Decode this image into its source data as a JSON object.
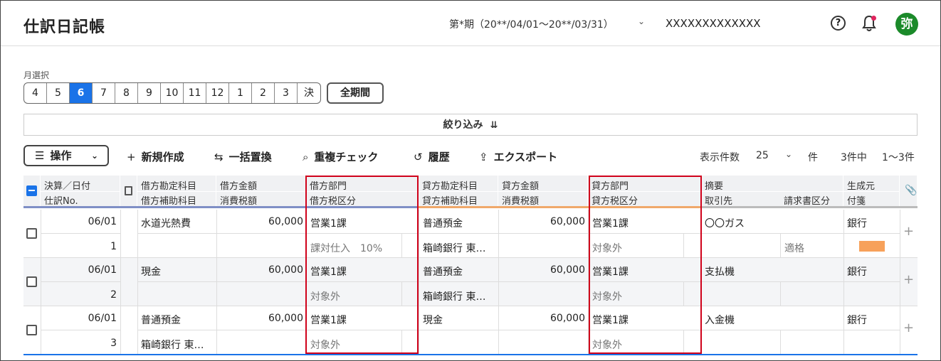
{
  "app": {
    "title": "仕訳日記帳",
    "period": "第*期（20**/04/01〜20**/03/31）",
    "company": "XXXXXXXXXXXXX",
    "avatar": "弥"
  },
  "icons": {
    "period_chevron": "chevron-down-icon",
    "help": "help-icon",
    "bell": "bell-icon",
    "filter": "double-chevron-down-icon",
    "ops_menu": "hamburger-icon",
    "ops_dropdown": "chevron-down-icon",
    "new": "plus-icon",
    "replace": "replace-icon",
    "dup": "search-duplicate-icon",
    "history": "history-icon",
    "export": "export-icon",
    "count_chevron": "chevron-down-icon",
    "book": "book-icon",
    "attach": "paperclip-icon",
    "add_row": "plus-icon"
  },
  "month_select": {
    "label": "月選択",
    "months": [
      "4",
      "5",
      "6",
      "7",
      "8",
      "9",
      "10",
      "11",
      "12",
      "1",
      "2",
      "3",
      "決"
    ],
    "active": "6",
    "all_period": "全期間"
  },
  "filter": {
    "label": "絞り込み"
  },
  "toolbar": {
    "ops": "操作",
    "new": "新規作成",
    "bulk_replace": "一括置換",
    "dup_check": "重複チェック",
    "history": "履歴",
    "export": "エクスポート",
    "count_label": "表示件数",
    "count_value": "25",
    "count_unit": "件",
    "total": "3件中",
    "range": "1〜3件"
  },
  "columns": {
    "date": "決算／日付",
    "no": "仕訳No.",
    "debit_account": "借方勘定科目",
    "debit_sub": "借方補助科目",
    "debit_amount": "借方金額",
    "debit_tax": "消費税額",
    "debit_dept": "借方部門",
    "debit_tax_class": "借方税区分",
    "credit_account": "貸方勘定科目",
    "credit_sub": "貸方補助科目",
    "credit_amount": "貸方金額",
    "credit_tax": "消費税額",
    "credit_dept": "貸方部門",
    "credit_tax_class": "貸方税区分",
    "memo": "摘要",
    "partner": "取引先",
    "invoice": "請求書区分",
    "origin": "生成元",
    "tag": "付箋"
  },
  "colors": {
    "accent": "#1a73e8",
    "debit_bar": "#7f8fc6",
    "credit_bar": "#f0a86a",
    "highlight": "#d0021b",
    "tag": "#f7a15a",
    "avatar": "#1b8a2a"
  },
  "rows": [
    {
      "date": "06/01",
      "no": "1",
      "debit_account": "水道光熱費",
      "debit_sub": "",
      "debit_amount": "60,000",
      "debit_dept": "営業1課",
      "debit_tax_class": "課対仕入　10%",
      "credit_account": "普通預金",
      "credit_sub": "箱崎銀行 東…",
      "credit_amount": "60,000",
      "credit_dept": "営業1課",
      "credit_tax_class": "対象外",
      "memo": "〇〇ガス",
      "partner": "",
      "invoice": "適格",
      "origin": "銀行"
    },
    {
      "date": "06/01",
      "no": "2",
      "debit_account": "現金",
      "debit_sub": "",
      "debit_amount": "60,000",
      "debit_dept": "営業1課",
      "debit_tax_class": "対象外",
      "credit_account": "普通預金",
      "credit_sub": "箱崎銀行 東…",
      "credit_amount": "60,000",
      "credit_dept": "営業1課",
      "credit_tax_class": "対象外",
      "memo": "支払機",
      "partner": "",
      "invoice": "",
      "origin": "銀行"
    },
    {
      "date": "06/01",
      "no": "3",
      "debit_account": "普通預金",
      "debit_sub": "箱崎銀行 東…",
      "debit_amount": "60,000",
      "debit_dept": "営業1課",
      "debit_tax_class": "対象外",
      "credit_account": "現金",
      "credit_sub": "",
      "credit_amount": "60,000",
      "credit_dept": "営業1課",
      "credit_tax_class": "対象外",
      "memo": "入金機",
      "partner": "",
      "invoice": "",
      "origin": "銀行"
    }
  ]
}
